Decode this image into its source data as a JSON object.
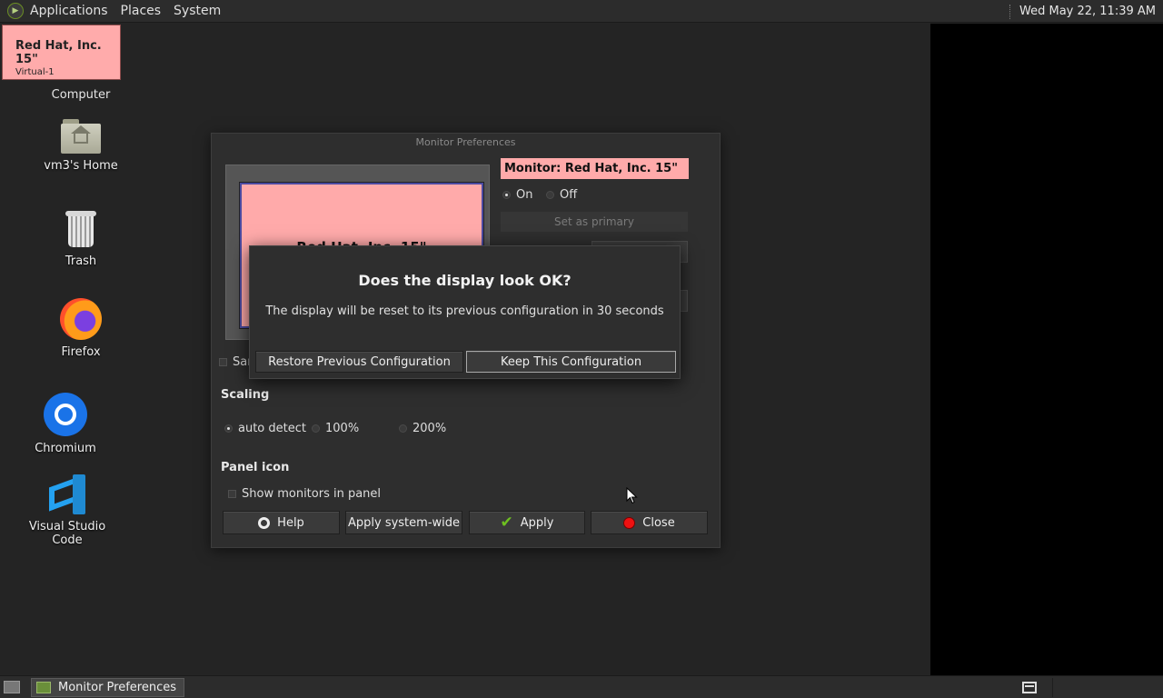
{
  "top_panel": {
    "menus": [
      "Applications",
      "Places",
      "System"
    ],
    "clock": "Wed May 22, 11:39 AM"
  },
  "desktop": {
    "computer": "Computer",
    "home": "vm3's Home",
    "trash": "Trash",
    "firefox": "Firefox",
    "chromium": "Chromium",
    "vscode": "Visual Studio Code"
  },
  "monitor_tooltip": {
    "name": "Red Hat, Inc. 15\"",
    "output": "Virtual-1"
  },
  "prefs": {
    "title": "Monitor Preferences",
    "preview_label": "Red Hat, Inc. 15\"",
    "monitor_label": "Monitor: Red Hat, Inc. 15\"",
    "on_label": "On",
    "off_label": "Off",
    "power_state": "On",
    "set_primary": "Set as primary",
    "same_image_label": "Sar",
    "scaling_title": "Scaling",
    "scaling_options": [
      "auto detect",
      "100%",
      "200%"
    ],
    "scaling_selected": "auto detect",
    "panel_icon_title": "Panel icon",
    "show_monitors_label": "Show monitors in panel",
    "buttons": {
      "help": "Help",
      "apply_system_wide": "Apply system-wide",
      "apply": "Apply",
      "close": "Close"
    }
  },
  "confirm": {
    "headline": "Does the display look OK?",
    "message": "The display will be reset to its previous configuration in 30 seconds",
    "restore": "Restore Previous Configuration",
    "keep": "Keep This Configuration"
  },
  "bottom_panel": {
    "task": "Monitor Preferences"
  },
  "colors": {
    "monitor_pink": "#ffaaaa",
    "panel_bg": "#2c2c2c",
    "apply_check": "#6ec020",
    "close_red": "#ee1111"
  }
}
